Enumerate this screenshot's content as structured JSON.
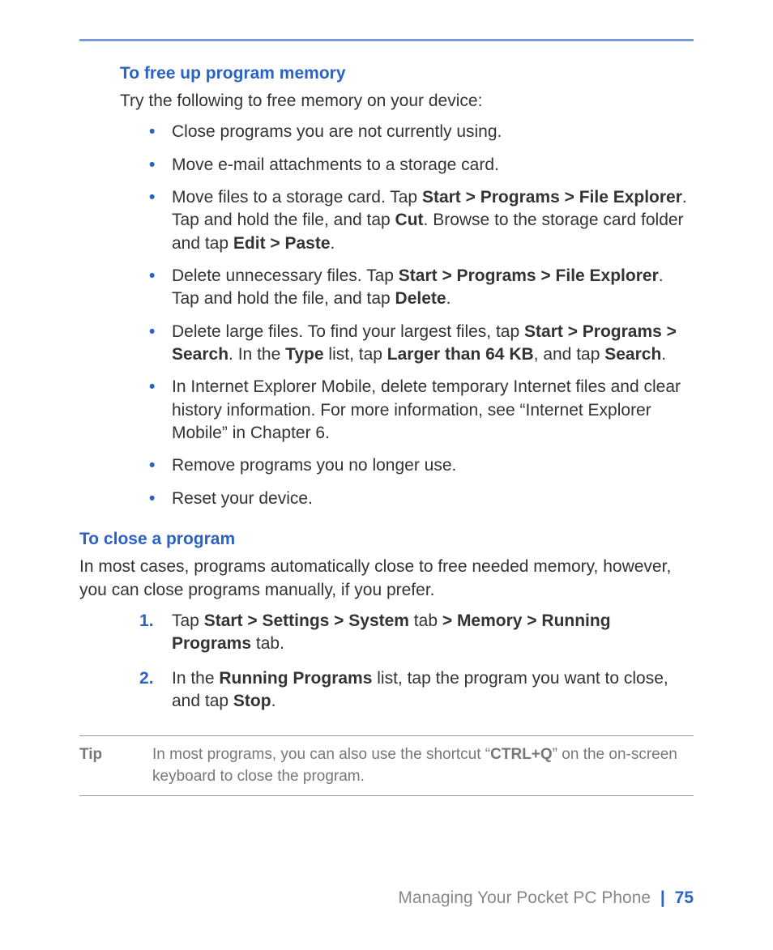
{
  "section1": {
    "heading": "To free up program memory",
    "intro": "Try the following to free memory on your device:",
    "bullets": [
      {
        "pre": "Close programs you are not currently using."
      },
      {
        "pre": "Move e-mail attachments to a storage card."
      },
      {
        "pre": "Move files to a storage card. Tap ",
        "b1": "Start > Programs > File Explorer",
        "mid1": ". Tap and hold the file, and tap ",
        "b2": "Cut",
        "mid2": ". Browse to the storage card folder and tap ",
        "b3": "Edit > Paste",
        "post": "."
      },
      {
        "pre": "Delete unnecessary files. Tap ",
        "b1": "Start > Programs > File Explorer",
        "mid1": ". Tap and hold the file, and tap ",
        "b2": "Delete",
        "post": "."
      },
      {
        "pre": "Delete large files. To find your largest files, tap ",
        "b1": "Start > Programs > Search",
        "mid1": ". In the ",
        "b2": "Type",
        "mid2": " list, tap ",
        "b3": "Larger than 64 KB",
        "mid3": ", and tap ",
        "b4": "Search",
        "post": "."
      },
      {
        "pre": "In Internet Explorer Mobile, delete temporary Internet files and clear history information. For more information, see “Internet Explorer Mobile” in Chapter 6."
      },
      {
        "pre": "Remove programs you no longer use."
      },
      {
        "pre": "Reset your device."
      }
    ]
  },
  "section2": {
    "heading": "To close a program",
    "intro": "In most cases, programs automatically close to free needed memory, however, you can close programs manually, if you prefer.",
    "steps": [
      {
        "pre": "Tap ",
        "b1": "Start > Settings > System",
        "mid1": " tab ",
        "b2": "> Memory > Running Programs",
        "post": " tab."
      },
      {
        "pre": "In the ",
        "b1": "Running Programs",
        "mid1": " list, tap the program you want to close, and tap ",
        "b2": "Stop",
        "post": "."
      }
    ]
  },
  "tip": {
    "label": "Tip",
    "pre": "In most programs, you can also use the shortcut “",
    "b1": "CTRL+Q",
    "post": "” on the on-screen keyboard to close the program."
  },
  "footer": {
    "title": "Managing Your Pocket PC Phone",
    "page": "75"
  }
}
